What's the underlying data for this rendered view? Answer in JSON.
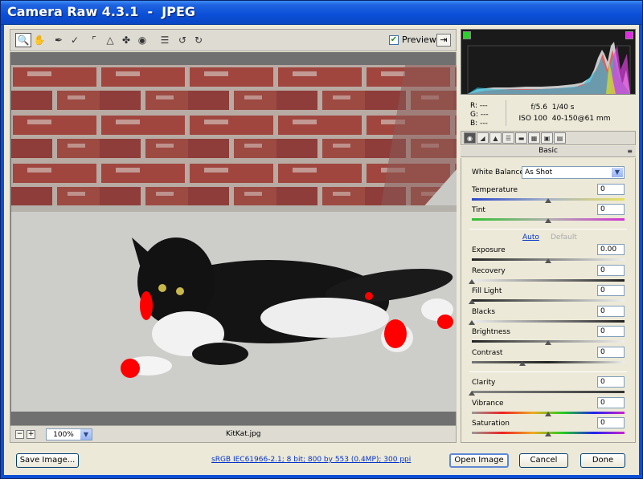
{
  "window": {
    "title": "Camera Raw 4.3.1  -  JPEG"
  },
  "toolbar": {
    "tools": [
      "zoom-tool-icon",
      "hand-tool-icon",
      "white-balance-tool-icon",
      "color-sampler-icon",
      "crop-tool-icon",
      "straighten-tool-icon",
      "spot-removal-icon",
      "red-eye-icon",
      "preferences-icon",
      "rotate-left-icon",
      "rotate-right-icon"
    ],
    "preview_label": "Preview",
    "preview_checked": true
  },
  "status": {
    "zoom": "100%",
    "filename": "KitKat.jpg",
    "zoom_out": "−",
    "zoom_in": "+"
  },
  "readout": {
    "r": "R:  ---",
    "g": "G:  ---",
    "b": "B:  ---",
    "aperture": "f/5.6",
    "shutter": "1/40 s",
    "iso": "ISO 100",
    "lens": "40-150@61 mm"
  },
  "panel": {
    "title": "Basic",
    "white_balance": {
      "label": "White Balance:",
      "value": "As Shot"
    },
    "auto_label": "Auto",
    "default_label": "Default",
    "sliders": {
      "temperature": {
        "label": "Temperature",
        "value": "0",
        "pos": 0.5
      },
      "tint": {
        "label": "Tint",
        "value": "0",
        "pos": 0.5
      },
      "exposure": {
        "label": "Exposure",
        "value": "0.00",
        "pos": 0.5
      },
      "recovery": {
        "label": "Recovery",
        "value": "0",
        "pos": 0.0
      },
      "fill_light": {
        "label": "Fill Light",
        "value": "0",
        "pos": 0.0
      },
      "blacks": {
        "label": "Blacks",
        "value": "0",
        "pos": 0.0
      },
      "brightness": {
        "label": "Brightness",
        "value": "0",
        "pos": 0.5
      },
      "contrast": {
        "label": "Contrast",
        "value": "0",
        "pos": 0.33
      },
      "clarity": {
        "label": "Clarity",
        "value": "0",
        "pos": 0.0
      },
      "vibrance": {
        "label": "Vibrance",
        "value": "0",
        "pos": 0.5
      },
      "saturation": {
        "label": "Saturation",
        "value": "0",
        "pos": 0.5
      }
    }
  },
  "footer": {
    "save": "Save Image...",
    "workflow": "sRGB IEC61966-2.1; 8 bit; 800 by 553 (0.4MP); 300 ppi",
    "open": "Open Image",
    "cancel": "Cancel",
    "done": "Done"
  },
  "colors": {
    "title_bar": "#0a4fd8",
    "clip_warning": "#ff0000"
  }
}
